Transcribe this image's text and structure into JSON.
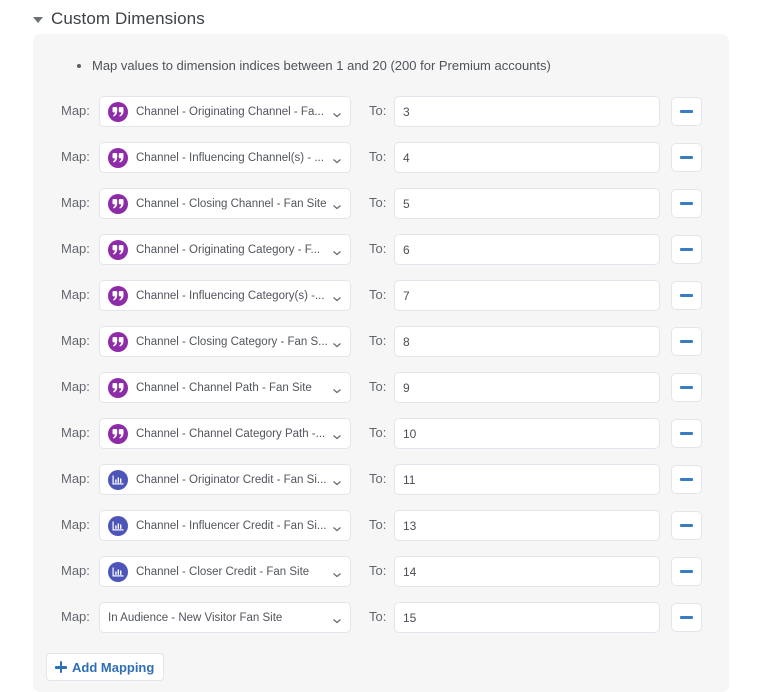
{
  "section": {
    "title": "Custom Dimensions",
    "hint": "Map values to dimension indices between 1 and 20 (200 for Premium accounts)"
  },
  "labels": {
    "map": "Map:",
    "to": "To:"
  },
  "colors": {
    "quote_badge": "#8e2ba8",
    "chart_badge": "#4d56b8",
    "accent": "#2f6fb6"
  },
  "mappings": [
    {
      "icon": "quote-icon",
      "value": "Channel - Originating Channel - Fa...",
      "to": "3"
    },
    {
      "icon": "quote-icon",
      "value": "Channel - Influencing Channel(s) - ...",
      "to": "4"
    },
    {
      "icon": "quote-icon",
      "value": "Channel - Closing Channel - Fan Site",
      "to": "5"
    },
    {
      "icon": "quote-icon",
      "value": "Channel - Originating Category - F...",
      "to": "6"
    },
    {
      "icon": "quote-icon",
      "value": "Channel - Influencing Category(s) -...",
      "to": "7"
    },
    {
      "icon": "quote-icon",
      "value": "Channel - Closing Category - Fan S...",
      "to": "8"
    },
    {
      "icon": "quote-icon",
      "value": "Channel - Channel Path - Fan Site",
      "to": "9"
    },
    {
      "icon": "quote-icon",
      "value": "Channel - Channel Category Path -...",
      "to": "10"
    },
    {
      "icon": "bar-chart-icon",
      "value": "Channel - Originator Credit - Fan Si...",
      "to": "11"
    },
    {
      "icon": "bar-chart-icon",
      "value": "Channel - Influencer Credit - Fan Si...",
      "to": "13"
    },
    {
      "icon": "bar-chart-icon",
      "value": "Channel - Closer Credit - Fan Site",
      "to": "14"
    },
    {
      "icon": "none",
      "value": "In Audience - New Visitor Fan Site",
      "to": "15"
    }
  ],
  "add_button": {
    "label": "Add Mapping"
  }
}
